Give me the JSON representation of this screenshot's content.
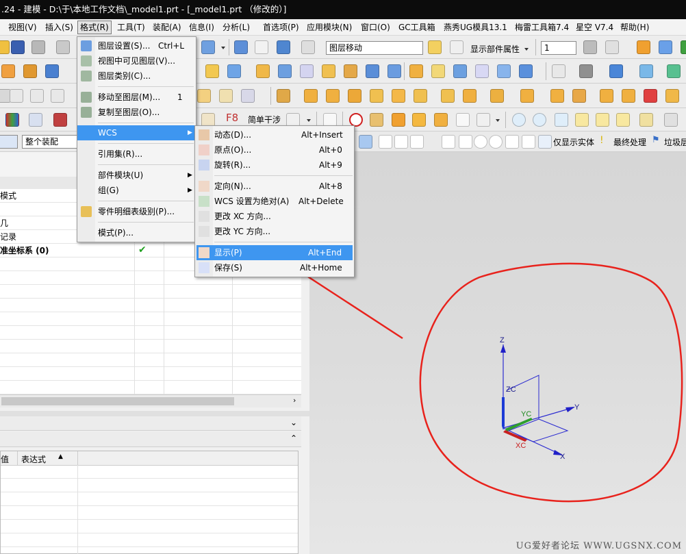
{
  "window": {
    "title": ".24 - 建模 - D:\\于\\本地工作文档\\_model1.prt - [_model1.prt （修改的）]"
  },
  "menubar": {
    "items": [
      "视图(V)",
      "插入(S)",
      "格式(R)",
      "工具(T)",
      "装配(A)",
      "信息(I)",
      "分析(L)",
      "首选项(P)",
      "应用模块(N)",
      "窗口(O)",
      "GC工具箱",
      "燕秀UG模具13.1",
      "梅雷工具箱7.4",
      "星空 V7.4",
      "帮助(H)"
    ]
  },
  "toolbar": {
    "layer_combo": "图层移动",
    "display_part_props": "显示部件属性",
    "layer_number": "1",
    "f8_label": "F8",
    "simple_interference": "简单干涉",
    "assembly_scope": "整个装配",
    "show_solid_only": "仅显示实体",
    "final_process": "最终处理",
    "trash_layer": "垃圾层"
  },
  "format_menu": {
    "items": [
      {
        "label": "图层设置(S)...",
        "shortcut": "Ctrl+L",
        "icon": "layer-settings-icon"
      },
      {
        "label": "视图中可见图层(V)...",
        "shortcut": "",
        "icon": "visible-layers-icon"
      },
      {
        "label": "图层类别(C)...",
        "shortcut": "",
        "icon": "layer-category-icon"
      },
      {
        "label": "移动至图层(M)...",
        "shortcut": "1",
        "icon": "move-to-layer-icon"
      },
      {
        "label": "复制至图层(O)...",
        "shortcut": "",
        "icon": "copy-to-layer-icon"
      },
      {
        "label": "WCS",
        "shortcut": "",
        "icon": ""
      },
      {
        "label": "引用集(R)...",
        "shortcut": "",
        "icon": ""
      },
      {
        "label": "部件模块(U)",
        "shortcut": "",
        "icon": ""
      },
      {
        "label": "组(G)",
        "shortcut": "",
        "icon": ""
      },
      {
        "label": "零件明细表级别(P)...",
        "shortcut": "",
        "icon": "parts-list-icon"
      },
      {
        "label": "模式(P)...",
        "shortcut": "",
        "icon": ""
      }
    ]
  },
  "wcs_menu": {
    "items": [
      {
        "label": "动态(D)...",
        "shortcut": "Alt+Insert"
      },
      {
        "label": "原点(O)...",
        "shortcut": "Alt+0"
      },
      {
        "label": "旋转(R)...",
        "shortcut": "Alt+9"
      },
      {
        "label": "定向(N)...",
        "shortcut": "Alt+8"
      },
      {
        "label": "WCS 设置为绝对(A)",
        "shortcut": "Alt+Delete"
      },
      {
        "label": "更改 XC 方向...",
        "shortcut": ""
      },
      {
        "label": "更改 YC 方向...",
        "shortcut": ""
      },
      {
        "label": "显示(P)",
        "shortcut": "Alt+End"
      },
      {
        "label": "保存(S)",
        "shortcut": "Alt+Home"
      }
    ]
  },
  "navigator": {
    "rows": [
      "模式",
      "",
      "几",
      "记录",
      "准坐标系 (0)"
    ],
    "lower_header": "表达式"
  },
  "axes": {
    "z": "Z",
    "y": "Y",
    "x": "X",
    "zc": "ZC",
    "yc": "YC",
    "xc": "XC"
  },
  "colors": {
    "highlight": "#3e96f0",
    "annotation": "#e8221c",
    "axis_blue": "#1c3bd6"
  },
  "watermark": "UG爱好者论坛 WWW.UGSNX.COM"
}
